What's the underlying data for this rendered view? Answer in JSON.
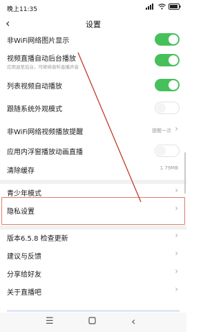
{
  "status": {
    "time": "晚上11:35"
  },
  "header": {
    "title": "设置"
  },
  "rows": [
    {
      "label": "非WiFi网络图片显示"
    },
    {
      "label": "视频直播自动后台播放",
      "sub": "应用退至后台，可继续收听直播声音"
    },
    {
      "label": "列表视频自动播放"
    },
    {
      "label": "跟随系统外观模式"
    },
    {
      "label": "非WiFi网络视频播放提醒",
      "value": "提醒一次"
    },
    {
      "label": "应用内浮窗播放动画直播"
    },
    {
      "label": "清除缓存",
      "value": "1.79MB"
    },
    {
      "label": "青少年模式"
    },
    {
      "label": "隐私设置"
    },
    {
      "label": "版本6.5.8  检查更新"
    },
    {
      "label": "建议与反馈"
    },
    {
      "label": "分享给好友"
    },
    {
      "label": "关于直播吧"
    }
  ],
  "toggles": {
    "wifi_image": "on",
    "background_play": "on",
    "list_autoplay": "on",
    "follow_system": "off",
    "float_window": "off"
  },
  "colors": {
    "toggle_on": "#46c05a",
    "highlight": "#e07b6b",
    "annotation_line": "#c0392b"
  }
}
